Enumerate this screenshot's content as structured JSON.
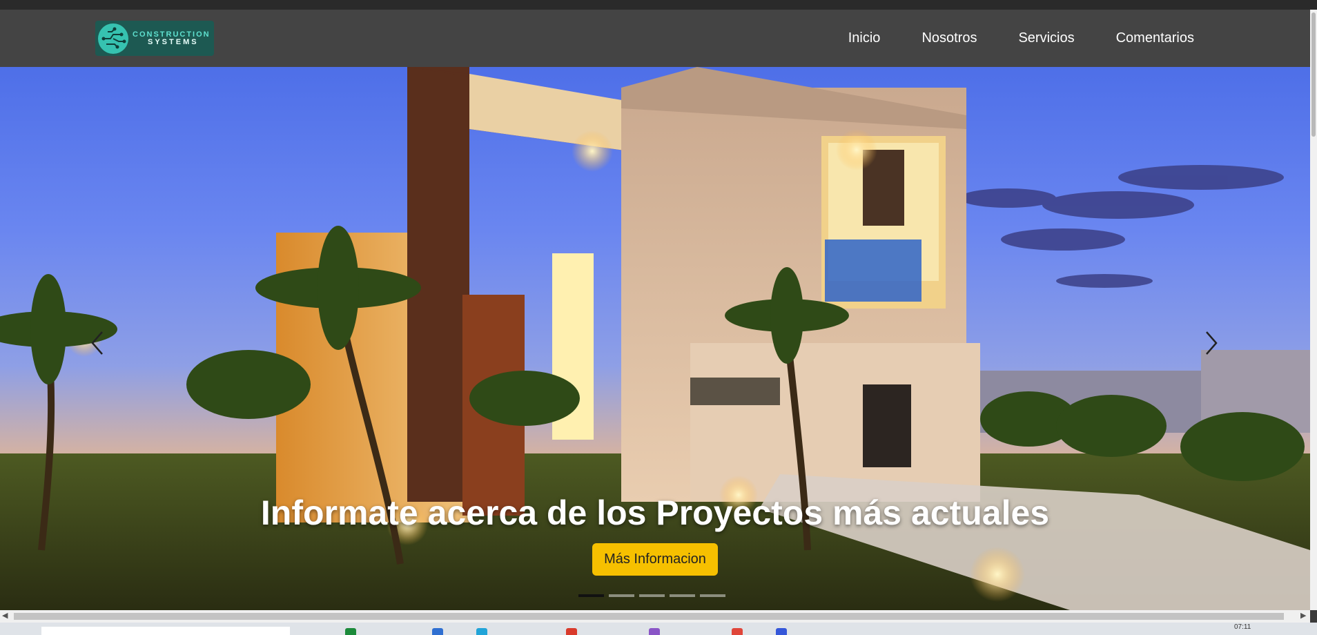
{
  "navbar": {
    "logo": {
      "line1": "CONSTRUCTION",
      "line2": "SYSTEMS",
      "icon": "circuit-logo-icon"
    },
    "links": [
      "Inicio",
      "Nosotros",
      "Servicios",
      "Comentarios"
    ]
  },
  "hero": {
    "caption": "Informate acerca de los Proyectos más actuales",
    "button": "Más Informacion",
    "indicator_count": 5,
    "active_indicator": 1,
    "prev_icon": "chevron-left-icon",
    "next_icon": "chevron-right-icon"
  },
  "taskbar": {
    "clock": "07:11"
  },
  "colors": {
    "navbar_bg": "#444444",
    "button_bg": "#f6c000",
    "logo_bg": "#1d5952",
    "logo_accent": "#36c2b0"
  }
}
